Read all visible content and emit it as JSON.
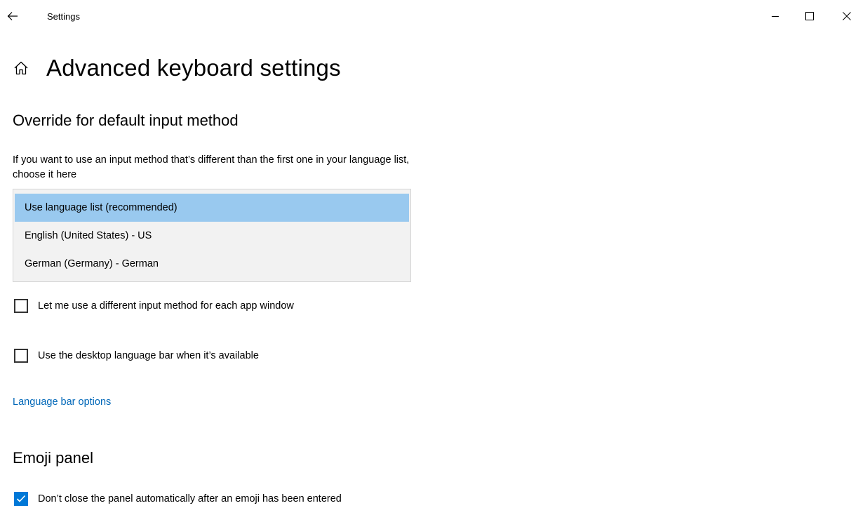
{
  "window": {
    "app_title": "Settings",
    "back_icon": "arrow-left-icon",
    "minimize_icon": "minimize-icon",
    "maximize_icon": "maximize-icon",
    "close_icon": "close-icon"
  },
  "header": {
    "home_icon": "home-icon",
    "title": "Advanced keyboard settings"
  },
  "override_section": {
    "title": "Override for default input method",
    "description": "If you want to use an input method that’s different than the first one in your language list, choose it here",
    "options": [
      {
        "label": "Use language list (recommended)",
        "selected": true
      },
      {
        "label": "English (United States) - US",
        "selected": false
      },
      {
        "label": "German (Germany) - German",
        "selected": false
      }
    ],
    "per_app_checkbox": {
      "label": "Let me use a different input method for each app window",
      "checked": false
    },
    "language_bar_checkbox": {
      "label": "Use the desktop language bar when it’s available",
      "checked": false
    },
    "language_bar_link": "Language bar options"
  },
  "emoji_section": {
    "title": "Emoji panel",
    "keep_open_checkbox": {
      "label": "Don’t close the panel automatically after an emoji has been entered",
      "checked": true
    }
  },
  "colors": {
    "accent": "#0078d7",
    "selection": "#99c9ef",
    "link": "#0067b8",
    "listbox_bg": "#f2f2f2"
  }
}
